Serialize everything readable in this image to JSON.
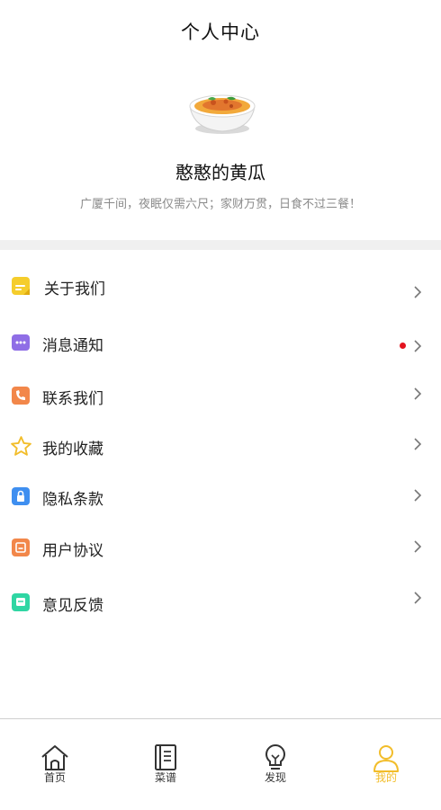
{
  "header": {
    "title": "个人中心"
  },
  "profile": {
    "avatar_icon": "noodle-bowl-icon",
    "name": "憨憨的黄瓜",
    "motto": "广厦千间，夜眠仅需六尺；家财万贯，日食不过三餐！"
  },
  "menu": {
    "items": [
      {
        "label": "关于我们",
        "icon": "note-icon",
        "color": "#f5cd2c"
      },
      {
        "label": "消息通知",
        "icon": "message-icon",
        "color": "#8f6ee6",
        "has_badge": true
      },
      {
        "label": "联系我们",
        "icon": "phone-icon",
        "color": "#f2874a"
      },
      {
        "label": "我的收藏",
        "icon": "star-icon",
        "color": "#f2bd2a"
      },
      {
        "label": "隐私条款",
        "icon": "lock-icon",
        "color": "#3f8ff0"
      },
      {
        "label": "用户协议",
        "icon": "document-icon",
        "color": "#f2874a"
      },
      {
        "label": "意见反馈",
        "icon": "feedback-icon",
        "color": "#2fd6a3"
      }
    ],
    "badge_color": "#e3131f"
  },
  "tabbar": {
    "tabs": [
      {
        "label": "首页",
        "icon": "home-icon"
      },
      {
        "label": "菜谱",
        "icon": "recipe-book-icon"
      },
      {
        "label": "发现",
        "icon": "lightbulb-icon"
      },
      {
        "label": "我的",
        "icon": "user-icon",
        "active": true
      }
    ],
    "active_color": "#f2bd2a"
  }
}
